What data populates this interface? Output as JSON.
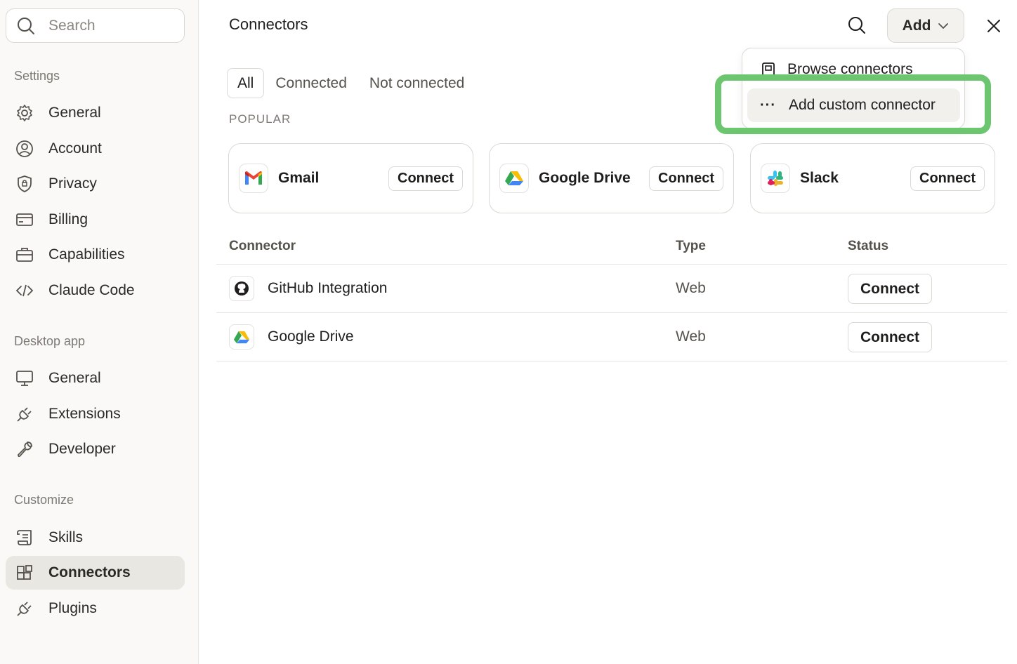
{
  "sidebar": {
    "search_placeholder": "Search",
    "sections": {
      "settings": "Settings",
      "desktop": "Desktop app",
      "customize": "Customize"
    },
    "settings_items": [
      {
        "label": "General",
        "icon": "gear-icon"
      },
      {
        "label": "Account",
        "icon": "user-circle-icon"
      },
      {
        "label": "Privacy",
        "icon": "shield-icon"
      },
      {
        "label": "Billing",
        "icon": "credit-card-icon"
      },
      {
        "label": "Capabilities",
        "icon": "briefcase-icon"
      },
      {
        "label": "Claude Code",
        "icon": "code-icon"
      }
    ],
    "desktop_items": [
      {
        "label": "General",
        "icon": "monitor-icon"
      },
      {
        "label": "Extensions",
        "icon": "plug-icon"
      },
      {
        "label": "Developer",
        "icon": "wrench-icon"
      }
    ],
    "customize_items": [
      {
        "label": "Skills",
        "icon": "scroll-icon"
      },
      {
        "label": "Connectors",
        "icon": "grid-plus-icon",
        "active": true
      },
      {
        "label": "Plugins",
        "icon": "plug-icon"
      }
    ]
  },
  "header": {
    "title": "Connectors",
    "add_label": "Add"
  },
  "tabs": [
    "All",
    "Connected",
    "Not connected"
  ],
  "popular": {
    "label": "POPULAR",
    "cards": [
      {
        "name": "Gmail",
        "button": "Connect",
        "icon": "gmail-icon"
      },
      {
        "name": "Google Drive",
        "button": "Connect",
        "icon": "google-drive-icon"
      },
      {
        "name": "Slack",
        "button": "Connect",
        "icon": "slack-icon"
      }
    ]
  },
  "table": {
    "headers": [
      "Connector",
      "Type",
      "Status"
    ],
    "rows": [
      {
        "name": "GitHub Integration",
        "type": "Web",
        "status": "Connect",
        "icon": "github-icon"
      },
      {
        "name": "Google Drive",
        "type": "Web",
        "status": "Connect",
        "icon": "google-drive-icon"
      }
    ]
  },
  "dropdown": {
    "items": [
      {
        "label": "Browse connectors",
        "icon": "book-icon"
      },
      {
        "label": "Add custom connector",
        "icon": "ellipsis-icon",
        "highlighted": true
      }
    ]
  },
  "colors": {
    "highlight": "#6cc66f",
    "active_nav": "#e9e7e2",
    "sidebar_bg": "#faf9f7"
  }
}
